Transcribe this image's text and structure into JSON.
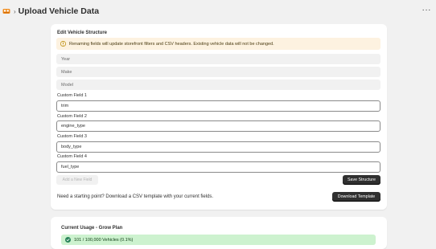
{
  "header": {
    "page_title": "Upload Vehicle Data",
    "separator": "›",
    "more_menu": "···"
  },
  "structure_card": {
    "title": "Edit Vehicle Structure",
    "banner_text": "Renaming fields will update storefront filters and CSV headers. Existing vehicle data will not be changed.",
    "fixed_fields": [
      "Year",
      "Make",
      "Model"
    ],
    "custom_fields": [
      {
        "label": "Custom Field 1",
        "value": "trim"
      },
      {
        "label": "Custom Field 2",
        "value": "engine_type"
      },
      {
        "label": "Custom Field 3",
        "value": "body_type"
      },
      {
        "label": "Custom Field 4",
        "value": "fuel_type"
      }
    ],
    "add_field_label": "Add a New Field",
    "save_label": "Save Structure",
    "template_text": "Need a starting point? Download a CSV template with your current fields.",
    "download_label": "Download Template"
  },
  "usage_card": {
    "title": "Current Usage - Grow Plan",
    "usage_text": "101 / 100,000 Vehicles (0.1%)",
    "usage_fraction": 0.001
  },
  "colors": {
    "background": "#f1f1f1",
    "card": "#ffffff",
    "banner": "#fdf2e0",
    "warning_icon": "#b98900",
    "primary_button": "#303030",
    "success_bar": "#cdf2cf",
    "success_icon": "#29845a"
  },
  "icons": {
    "app": "vehicle-app-icon",
    "banner": "warning-icon",
    "usage": "check-circle-icon",
    "menu": "more-horizontal-icon"
  }
}
